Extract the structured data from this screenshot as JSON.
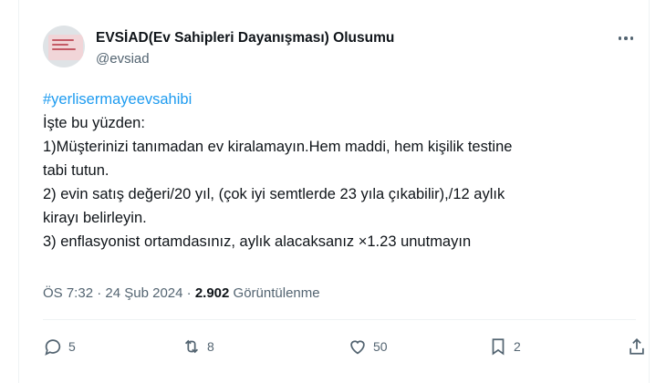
{
  "author": {
    "name": "EVSİAD(Ev Sahipleri Dayanışması) Olusumu",
    "handle": "@evsiad"
  },
  "tweet": {
    "hashtag": "#yerlisermayeevsahibi",
    "lines": [
      "İşte bu yüzden:",
      "1)Müşterinizi tanımadan ev kiralamayın.Hem maddi, hem kişilik testine",
      "tabi tutun.",
      "2) evin satış değeri/20 yıl, (çok iyi semtlerde 23 yıla çıkabilir),/12 aylık",
      "kirayı belirleyin.",
      "3) enflasyonist ortamdasınız, aylık alacaksanız ×1.23 unutmayın"
    ]
  },
  "meta": {
    "time": "ÖS 7:32",
    "separator": "·",
    "date": "24 Şub 2024",
    "views": "2.902",
    "views_label": "Görüntülenme"
  },
  "actions": {
    "replies": "5",
    "retweets": "8",
    "likes": "50",
    "bookmarks": "2"
  },
  "icons": [
    "more-icon",
    "reply-icon",
    "retweet-icon",
    "like-icon",
    "bookmark-icon",
    "share-icon"
  ],
  "colors": {
    "hashtag": "#1d9bf0",
    "secondary_text": "#536471",
    "primary_text": "#0f1419"
  }
}
